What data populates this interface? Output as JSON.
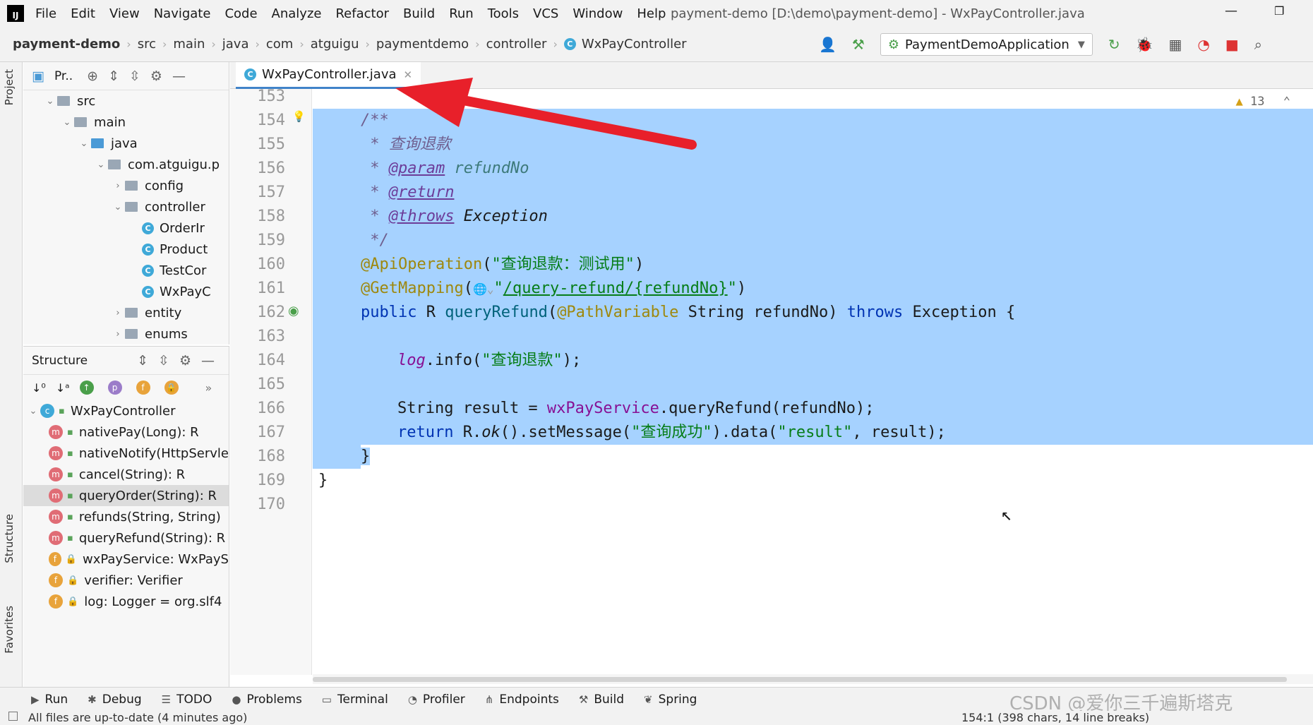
{
  "window": {
    "app_logo": "IJ",
    "title": "payment-demo [D:\\demo\\payment-demo] - WxPayController.java",
    "minimize": "—",
    "maximize": "❐"
  },
  "menu": [
    "File",
    "Edit",
    "View",
    "Navigate",
    "Code",
    "Analyze",
    "Refactor",
    "Build",
    "Run",
    "Tools",
    "VCS",
    "Window",
    "Help"
  ],
  "breadcrumb": [
    "payment-demo",
    "src",
    "main",
    "java",
    "com",
    "atguigu",
    "paymentdemo",
    "controller",
    "WxPayController"
  ],
  "run_config": "PaymentDemoApplication",
  "project_panel": {
    "title": "Pr..",
    "tree": [
      {
        "label": "src",
        "level": 1,
        "expanded": true,
        "type": "folder"
      },
      {
        "label": "main",
        "level": 2,
        "expanded": true,
        "type": "folder"
      },
      {
        "label": "java",
        "level": 3,
        "expanded": true,
        "type": "folder-blue"
      },
      {
        "label": "com.atguigu.p",
        "level": 4,
        "expanded": true,
        "type": "package"
      },
      {
        "label": "config",
        "level": 5,
        "expanded": false,
        "type": "package"
      },
      {
        "label": "controller",
        "level": 5,
        "expanded": true,
        "type": "package"
      },
      {
        "label": "OrderIr",
        "level": 6,
        "type": "class"
      },
      {
        "label": "Product",
        "level": 6,
        "type": "class"
      },
      {
        "label": "TestCor",
        "level": 6,
        "type": "class"
      },
      {
        "label": "WxPayC",
        "level": 6,
        "type": "class"
      },
      {
        "label": "entity",
        "level": 5,
        "expanded": false,
        "type": "package"
      },
      {
        "label": "enums",
        "level": 5,
        "expanded": false,
        "type": "package"
      }
    ]
  },
  "structure_panel": {
    "title": "Structure",
    "root": "WxPayController",
    "items": [
      {
        "label": "nativePay(Long): R",
        "kind": "m",
        "access": "public"
      },
      {
        "label": "nativeNotify(HttpServle",
        "kind": "m",
        "access": "public"
      },
      {
        "label": "cancel(String): R",
        "kind": "m",
        "access": "public"
      },
      {
        "label": "queryOrder(String): R",
        "kind": "m",
        "access": "public",
        "selected": true
      },
      {
        "label": "refunds(String, String)",
        "kind": "m",
        "access": "public"
      },
      {
        "label": "queryRefund(String): R",
        "kind": "m",
        "access": "public"
      },
      {
        "label": "wxPayService: WxPayS",
        "kind": "f",
        "access": "private"
      },
      {
        "label": "verifier: Verifier",
        "kind": "f",
        "access": "private"
      },
      {
        "label": "log: Logger = org.slf4",
        "kind": "f",
        "access": "private"
      }
    ]
  },
  "side_tabs": {
    "project": "Project",
    "structure": "Structure",
    "favorites": "Favorites"
  },
  "editor": {
    "tab_label": "WxPayController.java",
    "warnings": "13",
    "line_numbers": [
      "153",
      "154",
      "155",
      "156",
      "157",
      "158",
      "159",
      "160",
      "161",
      "162",
      "163",
      "164",
      "165",
      "166",
      "167",
      "168",
      "169",
      "170"
    ],
    "code": {
      "l154": "/**",
      "l155_a": " * ",
      "l155_b": "查询退款",
      "l156_a": " * ",
      "l156_tag": "@param",
      "l156_b": " refundNo",
      "l157_a": " * ",
      "l157_tag": "@return",
      "l158_a": " * ",
      "l158_tag": "@throws",
      "l158_b": " Exception",
      "l159": " */",
      "l160_ann": "@ApiOperation",
      "l160_p1": "(",
      "l160_str": "\"查询退款：测试用\"",
      "l160_p2": ")",
      "l161_ann": "@GetMapping",
      "l161_p1": "(",
      "l161_globe": "🌐⌄",
      "l161_q1": "\"",
      "l161_url": "/query-refund/{refundNo}",
      "l161_q2": "\"",
      "l161_p2": ")",
      "l162_kw1": "public",
      "l162_a": " R ",
      "l162_m": "queryRefund",
      "l162_b": "(",
      "l162_ann": "@PathVariable",
      "l162_c": " String refundNo) ",
      "l162_kw2": "throws",
      "l162_d": " Exception {",
      "l164_fld": "log",
      "l164_a": ".info(",
      "l164_str": "\"查询退款\"",
      "l164_b": ");",
      "l166_a": "String result = ",
      "l166_fld": "wxPayService",
      "l166_b": ".queryRefund(refundNo);",
      "l167_kw": "return",
      "l167_a": " R.",
      "l167_it": "ok",
      "l167_b": "().setMessage(",
      "l167_str1": "\"查询成功\"",
      "l167_c": ").data(",
      "l167_str2": "\"result\"",
      "l167_d": ", result);",
      "l168": "}",
      "l169": "}"
    }
  },
  "bottom_tools": [
    "Run",
    "Debug",
    "TODO",
    "Problems",
    "Terminal",
    "Profiler",
    "Endpoints",
    "Build",
    "Spring"
  ],
  "status": {
    "message": "All files are up-to-date (4 minutes ago)",
    "position": "154:1 (398 chars, 14 line breaks)"
  },
  "watermark": "CSDN @爱你三千遍斯塔克",
  "colors": {
    "selection": "#a6d2ff",
    "arrow": "#e8202a",
    "accent": "#4083c9"
  }
}
